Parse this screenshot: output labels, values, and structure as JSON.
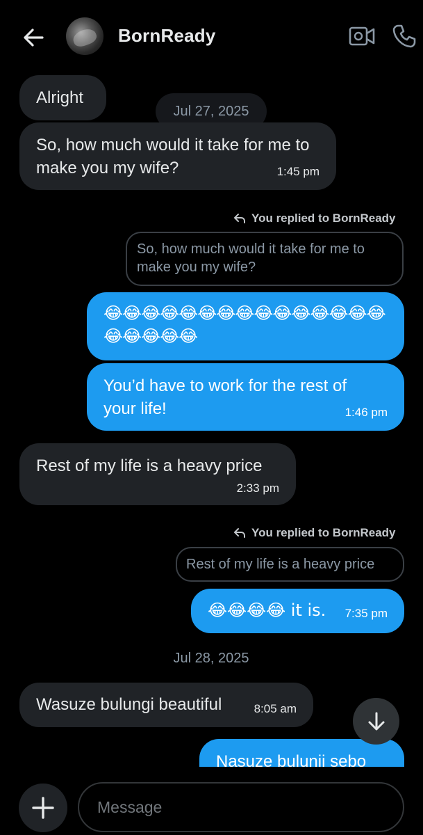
{
  "header": {
    "contact_name": "BornReady"
  },
  "messages": {
    "m1": {
      "text": "Alright"
    },
    "date1": "Jul 27, 2025",
    "m2": {
      "text": "So, how much would it take for me to make you my wife?",
      "time": "1:45 pm"
    },
    "reply1": {
      "label": "You replied to BornReady",
      "quote": "So, how much would it take for me to make you my wife?"
    },
    "m3": {
      "text": "😂😂😂😂😂😂😂😂😂😂😂😂😂😂😂😂😂😂😂😂"
    },
    "m4": {
      "text": "You’d have to work for the rest of your life!",
      "time": "1:46 pm"
    },
    "m5": {
      "text": "Rest of my life is a heavy price",
      "time": "2:33 pm"
    },
    "reply2": {
      "label": "You replied to BornReady",
      "quote": "Rest of my life is a heavy price"
    },
    "m6": {
      "text": "😂😂😂😂 it is.",
      "time": "7:35 pm"
    },
    "date2": "Jul 28, 2025",
    "m7": {
      "text": "Wasuze bulungi beautiful",
      "time": "8:05 am"
    },
    "m8": {
      "text": "Nasuze bulunii sebo"
    }
  },
  "composer": {
    "placeholder": "Message"
  },
  "colors": {
    "outgoing_bubble": "#1d9bf0",
    "incoming_bubble": "#202327",
    "background": "#000000"
  },
  "icons": [
    "back-arrow-icon",
    "video-call-icon",
    "phone-icon",
    "reply-arrow-icon",
    "arrow-down-icon",
    "plus-icon"
  ]
}
